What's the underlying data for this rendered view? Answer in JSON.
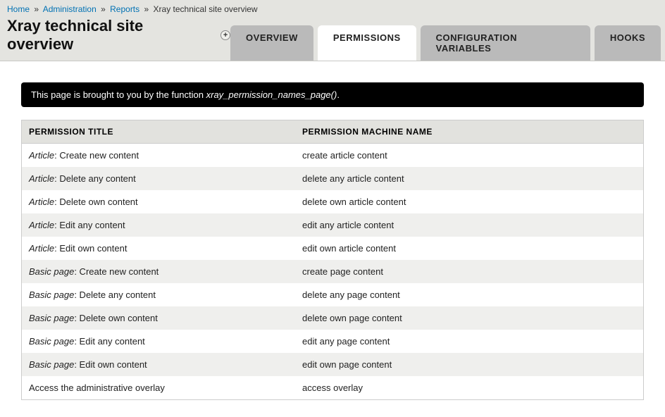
{
  "breadcrumb": {
    "links": [
      "Home",
      "Administration",
      "Reports"
    ],
    "current": "Xray technical site overview",
    "sep": "»"
  },
  "page_title": "Xray technical site overview",
  "tabs": [
    {
      "label": "OVERVIEW",
      "active": false
    },
    {
      "label": "PERMISSIONS",
      "active": true
    },
    {
      "label": "CONFIGURATION VARIABLES",
      "active": false
    },
    {
      "label": "HOOKS",
      "active": false
    }
  ],
  "info_bar": {
    "prefix": "This page is brought to you by the function ",
    "fn": "xray_permission_names_page()",
    "suffix": "."
  },
  "table": {
    "headers": [
      "PERMISSION TITLE",
      "PERMISSION MACHINE NAME"
    ],
    "rows": [
      {
        "prefix": "Article",
        "title": ": Create new content",
        "machine": "create article content"
      },
      {
        "prefix": "Article",
        "title": ": Delete any content",
        "machine": "delete any article content"
      },
      {
        "prefix": "Article",
        "title": ": Delete own content",
        "machine": "delete own article content"
      },
      {
        "prefix": "Article",
        "title": ": Edit any content",
        "machine": "edit any article content"
      },
      {
        "prefix": "Article",
        "title": ": Edit own content",
        "machine": "edit own article content"
      },
      {
        "prefix": "Basic page",
        "title": ": Create new content",
        "machine": "create page content"
      },
      {
        "prefix": "Basic page",
        "title": ": Delete any content",
        "machine": "delete any page content"
      },
      {
        "prefix": "Basic page",
        "title": ": Delete own content",
        "machine": "delete own page content"
      },
      {
        "prefix": "Basic page",
        "title": ": Edit any content",
        "machine": "edit any page content"
      },
      {
        "prefix": "Basic page",
        "title": ": Edit own content",
        "machine": "edit own page content"
      },
      {
        "prefix": "",
        "title": "Access the administrative overlay",
        "machine": "access overlay"
      }
    ]
  }
}
